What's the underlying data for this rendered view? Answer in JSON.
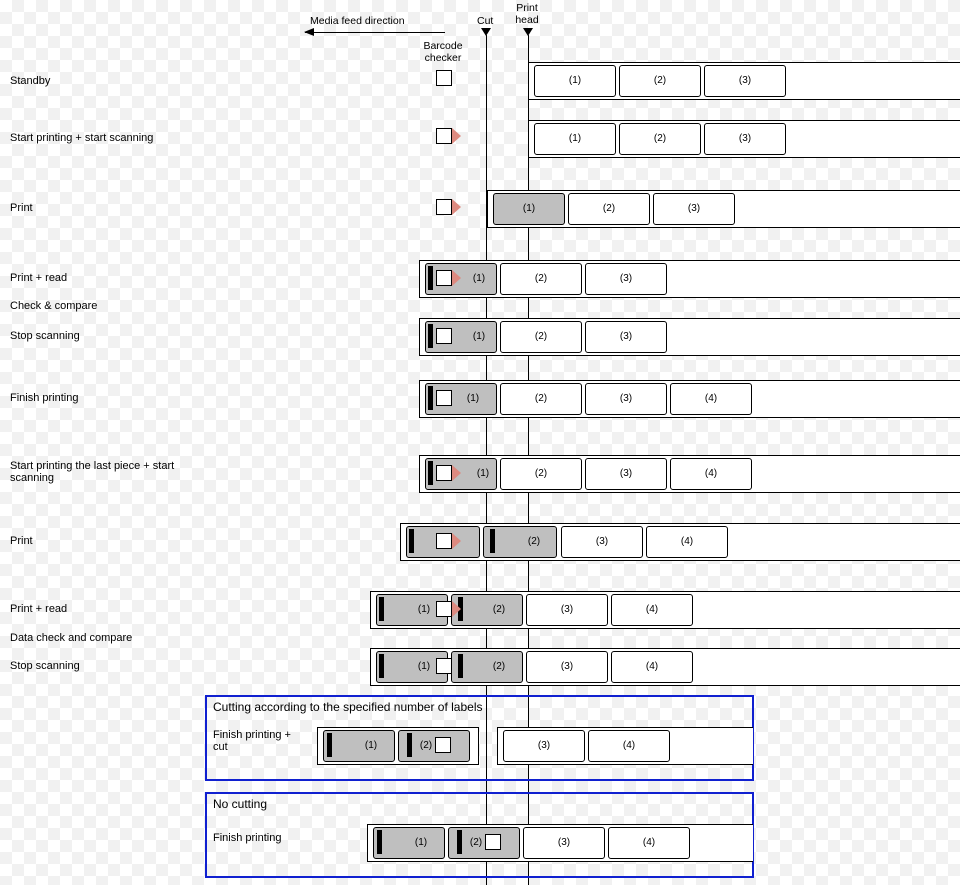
{
  "header": {
    "feed_direction": "Media feed direction",
    "cut": "Cut",
    "print_head": "Print head",
    "barcode_checker": "Barcode checker"
  },
  "rows": {
    "r1": "Standby",
    "r2": "Start printing + start scanning",
    "r3": "Print",
    "r4": "Print + read",
    "r4b": "Check & compare",
    "r5": "Stop scanning",
    "r6": "Finish printing",
    "r7": "Start printing the last piece + start scanning",
    "r8": "Print",
    "r9": "Print + read",
    "r9b": "Data check and compare",
    "r10": "Stop scanning"
  },
  "panels": {
    "cutting": {
      "title": "Cutting according to the specified number of labels",
      "row_label": "Finish printing + cut"
    },
    "nocut": {
      "title": "No cutting",
      "row_label": "Finish printing"
    }
  },
  "cells": {
    "n1": "(1)",
    "n2": "(2)",
    "n3": "(3)",
    "n4": "(4)"
  }
}
